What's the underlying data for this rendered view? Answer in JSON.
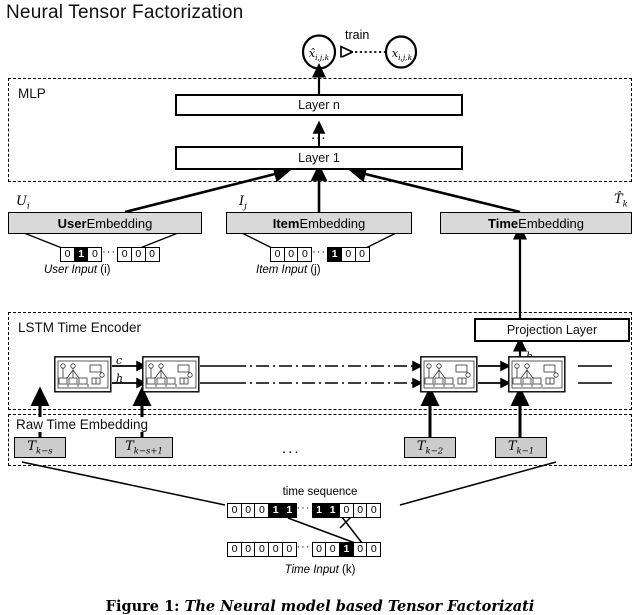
{
  "page_title": "Neural Tensor Factorization",
  "top": {
    "pred_node": "x̂",
    "pred_sub": "i,j,k",
    "true_node": "x",
    "true_sub": "i,j,k",
    "train_label": "train"
  },
  "mlp": {
    "group_label": "MLP",
    "layer_n": "Layer n",
    "layer_1": "Layer 1",
    "vdots": "..."
  },
  "embeddings": {
    "user": {
      "symbol": "U",
      "symbol_sub": "i",
      "bold": "User",
      "rest": " Embedding",
      "input_label_italic": "User Input",
      "input_label_rest": " (i)",
      "bits": [
        "0",
        "1",
        "0",
        "DOTS",
        "0",
        "0",
        "0"
      ],
      "on_index": 1
    },
    "item": {
      "symbol": "I",
      "symbol_sub": "j",
      "bold": "Item",
      "rest": " Embedding",
      "input_label_italic": "Item Input",
      "input_label_rest": " (j)",
      "bits": [
        "0",
        "0",
        "0",
        "DOTS",
        "1",
        "0",
        "0"
      ],
      "on_index": 4
    },
    "time": {
      "symbol": "T̂",
      "symbol_sub": "k",
      "bold": "Time",
      "rest": " Embedding"
    }
  },
  "lstm": {
    "group_label": "LSTM Time Encoder",
    "projection_layer": "Projection Layer",
    "c_label": "c",
    "h_label": "h",
    "h_out_label": "h",
    "cells": 4
  },
  "raw_time": {
    "group_label": "Raw Time Embedding",
    "boxes": [
      {
        "base": "T",
        "sub": "k−s"
      },
      {
        "base": "T",
        "sub": "k−s+1"
      },
      {
        "base": "T",
        "sub": "k−2"
      },
      {
        "base": "T",
        "sub": "k−1"
      }
    ],
    "ellipsis": "..."
  },
  "time_sequence": {
    "label": "time sequence",
    "row1": [
      "0",
      "0",
      "0",
      "1",
      "1",
      "DOTS",
      "1",
      "1",
      "0",
      "0",
      "0"
    ],
    "row1_on": [
      3,
      4,
      6,
      7
    ],
    "row2": [
      "0",
      "0",
      "0",
      "0",
      "0",
      "DOTS",
      "0",
      "0",
      "1",
      "0",
      "0"
    ],
    "row2_on": [
      8
    ],
    "input_label_italic": "Time Input",
    "input_label_rest": " (k)"
  },
  "caption": {
    "prefix": "Figure 1:",
    "text": " The Neural model based Tensor Factorizati"
  },
  "colors": {
    "stroke": "#000000",
    "embedding_fill": "#d9d9d9",
    "tbox_fill": "#cccccc",
    "bit_on": "#000000",
    "background": "#ffffff"
  }
}
